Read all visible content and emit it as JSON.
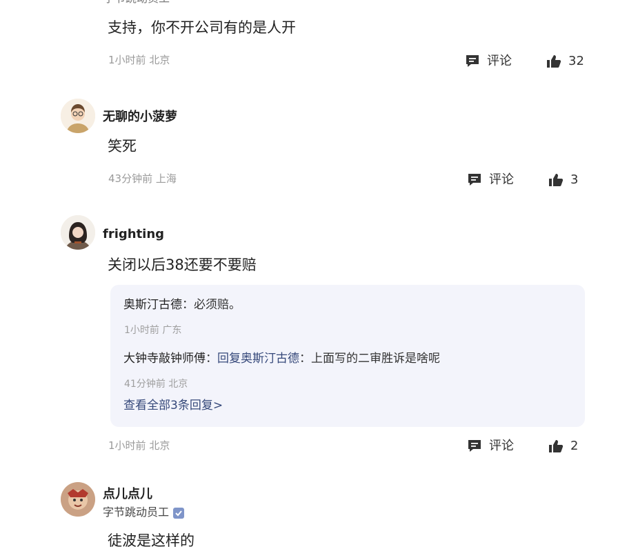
{
  "top_fragment": "字节跳动员工",
  "comments": [
    {
      "text": "支持，你不开公司有的是人开",
      "time": "1小时前",
      "location": "北京",
      "comment_label": "评论",
      "likes": "32"
    },
    {
      "username": "无聊的小菠萝",
      "text": "笑死",
      "time": "43分钟前",
      "location": "上海",
      "comment_label": "评论",
      "likes": "3"
    },
    {
      "username": "frighting",
      "text": "关闭以后38还要不要赔",
      "time": "1小时前",
      "location": "北京",
      "comment_label": "评论",
      "likes": "2",
      "replies": [
        {
          "author": "奥斯汀古德",
          "sep": "：",
          "text": "必须赔。",
          "time": "1小时前",
          "location": "广东"
        },
        {
          "author": "大钟寺敲钟师傅",
          "sep": "：",
          "reply_to_label": "回复奥斯汀古德",
          "text": "上面写的二审胜诉是啥呢",
          "time": "41分钟前",
          "location": "北京"
        }
      ],
      "view_all": "查看全部3条回复>"
    },
    {
      "username": "点儿点儿",
      "badge": "字节跳动员工",
      "text": "徒波是这样的"
    }
  ],
  "icons": {
    "comment": "comment-icon",
    "like": "thumbs-up-icon",
    "verified": "verified-icon"
  },
  "colors": {
    "reply_bg": "#f3f4fb",
    "link": "#35487a",
    "meta": "#9a9a9a"
  }
}
